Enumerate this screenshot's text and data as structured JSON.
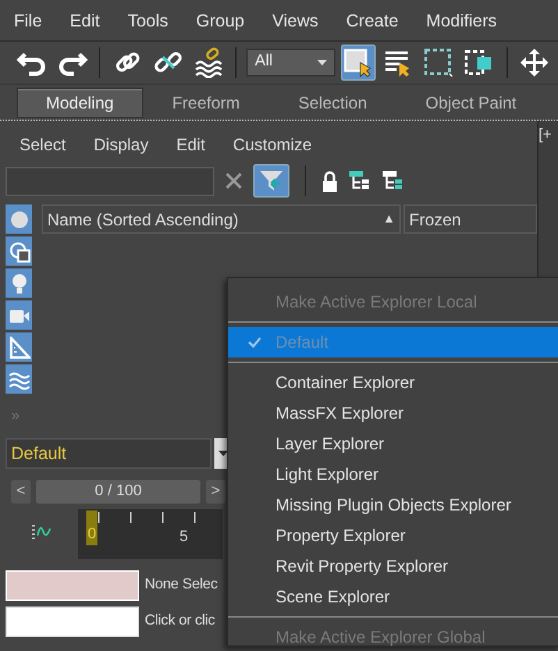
{
  "menu_bar": [
    "File",
    "Edit",
    "Tools",
    "Group",
    "Views",
    "Create",
    "Modifiers"
  ],
  "toolbar": {
    "selection_filter": "All",
    "select_object_active": true
  },
  "ribbon_tabs": [
    {
      "label": "Modeling",
      "selected": true
    },
    {
      "label": "Freeform",
      "selected": false
    },
    {
      "label": "Selection",
      "selected": false
    },
    {
      "label": "Object Paint",
      "selected": false
    }
  ],
  "viewport": {
    "label": "[+"
  },
  "explorer": {
    "menu": [
      "Select",
      "Display",
      "Edit",
      "Customize"
    ],
    "filter_active": true,
    "category_buttons": [
      {
        "on": true
      },
      {
        "on": true
      },
      {
        "on": true
      },
      {
        "on": true
      },
      {
        "on": true
      },
      {
        "on": true
      }
    ],
    "expand": "»",
    "columns": [
      {
        "label": "Name (Sorted Ascending)",
        "sort": "▲"
      },
      {
        "label": "Frozen"
      }
    ]
  },
  "layer_dropdown": {
    "value": "Default"
  },
  "time_slider": {
    "prev": "<",
    "reading": "0 / 100",
    "next": ">"
  },
  "trackbar": {
    "labels": [
      "0",
      "5"
    ]
  },
  "prompt": {
    "lines": [
      "None Selec",
      "Click or clic"
    ]
  },
  "context_menu": [
    {
      "kind": "item",
      "label": "Make Active Explorer Local",
      "disabled": true,
      "selected": false,
      "checked": false
    },
    {
      "kind": "separator"
    },
    {
      "kind": "item",
      "label": "Default",
      "disabled": true,
      "selected": true,
      "checked": true
    },
    {
      "kind": "separator"
    },
    {
      "kind": "item",
      "label": "Container Explorer",
      "disabled": false,
      "selected": false,
      "checked": false
    },
    {
      "kind": "item",
      "label": "MassFX Explorer",
      "disabled": false,
      "selected": false,
      "checked": false
    },
    {
      "kind": "item",
      "label": "Layer Explorer",
      "disabled": false,
      "selected": false,
      "checked": false
    },
    {
      "kind": "item",
      "label": "Light Explorer",
      "disabled": false,
      "selected": false,
      "checked": false
    },
    {
      "kind": "item",
      "label": "Missing Plugin Objects Explorer",
      "disabled": false,
      "selected": false,
      "checked": false
    },
    {
      "kind": "item",
      "label": "Property Explorer",
      "disabled": false,
      "selected": false,
      "checked": false
    },
    {
      "kind": "item",
      "label": "Revit Property Explorer",
      "disabled": false,
      "selected": false,
      "checked": false
    },
    {
      "kind": "item",
      "label": "Scene Explorer",
      "disabled": false,
      "selected": false,
      "checked": false
    },
    {
      "kind": "separator"
    },
    {
      "kind": "item",
      "label": "Make Active Explorer Global",
      "disabled": true,
      "selected": false,
      "checked": false
    }
  ]
}
